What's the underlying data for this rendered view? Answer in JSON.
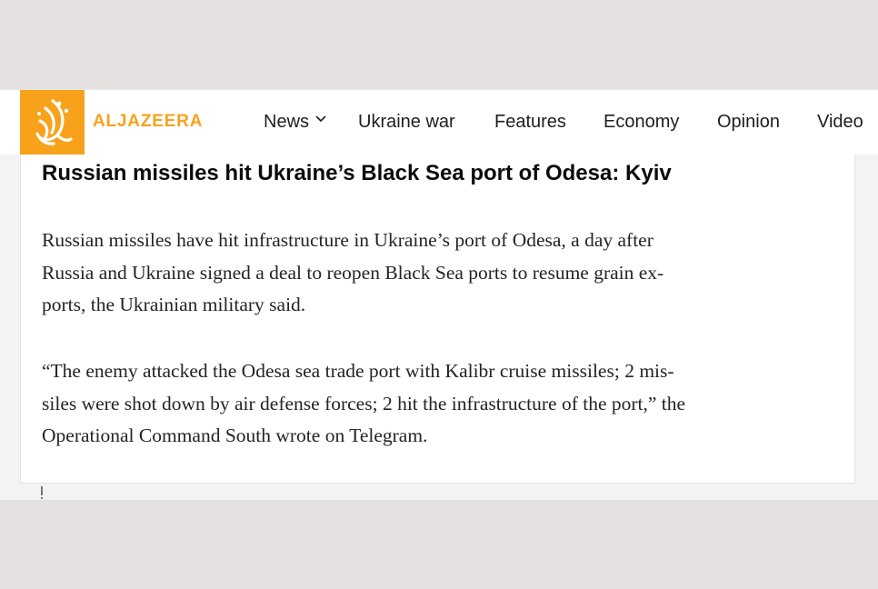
{
  "header": {
    "brand": "ALJAZEERA",
    "nav": [
      {
        "label": "News"
      },
      {
        "label": "Ukraine war"
      },
      {
        "label": "Features"
      },
      {
        "label": "Economy"
      },
      {
        "label": "Opinion"
      },
      {
        "label": "Video"
      }
    ]
  },
  "article": {
    "title": "Russian missiles hit Ukraine’s Black Sea port of Odesa: Kyiv",
    "paragraphs": [
      {
        "lines": [
          "Russian missiles have hit infrastructure in Ukraine’s port of Odesa, a day after",
          "Russia and Ukraine signed a deal to reopen Black Sea ports to resume grain ex-",
          "ports, the Ukrainian military said."
        ]
      },
      {
        "lines": [
          "“The enemy attacked the Odesa sea trade port with Kalibr cruise missiles; 2 mis-",
          "siles were shot down by air defense forces; 2 hit the infrastructure of the port,” the",
          "Operational Command South wrote on Telegram."
        ]
      }
    ]
  },
  "icons": {
    "logo": "aljazeera-calligraphy-logo-icon",
    "news_dropdown": "chevron-down-icon"
  },
  "colors": {
    "brand_orange": "#f8a21c",
    "text": "#0b0b0b",
    "background": "#e6e1e1"
  }
}
